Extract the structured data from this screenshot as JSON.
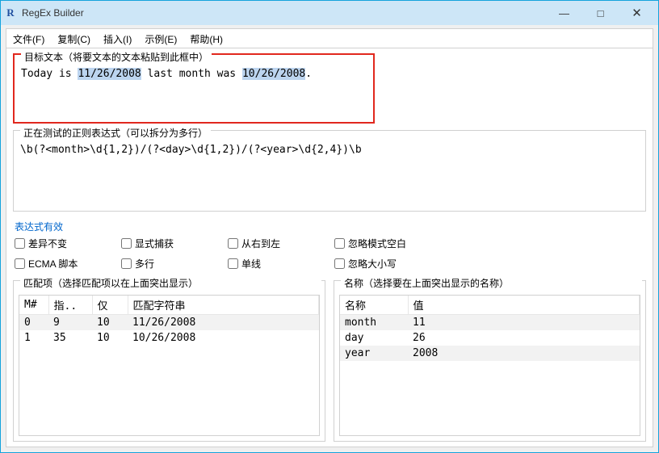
{
  "window": {
    "title": "RegEx Builder",
    "minimize": "—",
    "maximize": "□",
    "close": "✕"
  },
  "menu": {
    "file": "文件(F)",
    "copy": "复制(C)",
    "insert": "插入(I)",
    "sample": "示例(E)",
    "help": "帮助(H)"
  },
  "target_group_label": "目标文本（将要文本的文本粘贴到此框中）",
  "target_text_pre": "Today is ",
  "target_text_hl1": "11/26/2008",
  "target_text_mid": " last month was ",
  "target_text_hl2": "10/26/2008",
  "target_text_post": ".",
  "regex_group_label": "正在测试的正则表达式（可以拆分为多行）",
  "regex_text": "\\b(?<month>\\d{1,2})/(?<day>\\d{1,2})/(?<year>\\d{2,4})\\b",
  "status_label": "表达式有效",
  "options": {
    "diff": "差异不变",
    "explicit": "显式捕获",
    "rtl": "从右到左",
    "ignorews": "忽略模式空白",
    "ecma": "ECMA 脚本",
    "multiline": "多行",
    "single": "单线",
    "ignorecase": "忽略大小写"
  },
  "matches_group_label": "匹配项（选择匹配项以在上面突出显示）",
  "matches_headers": {
    "mnum": "M#",
    "index": "指..",
    "len": "仅",
    "value": "匹配字符串"
  },
  "matches": [
    {
      "m": "0",
      "index": "9",
      "len": "10",
      "value": "11/26/2008"
    },
    {
      "m": "1",
      "index": "35",
      "len": "10",
      "value": "10/26/2008"
    }
  ],
  "names_group_label": "名称（选择要在上面突出显示的名称）",
  "names_headers": {
    "name": "名称",
    "value": "值"
  },
  "names": [
    {
      "name": "month",
      "value": "11"
    },
    {
      "name": "day",
      "value": "26"
    },
    {
      "name": "year",
      "value": "2008"
    }
  ]
}
